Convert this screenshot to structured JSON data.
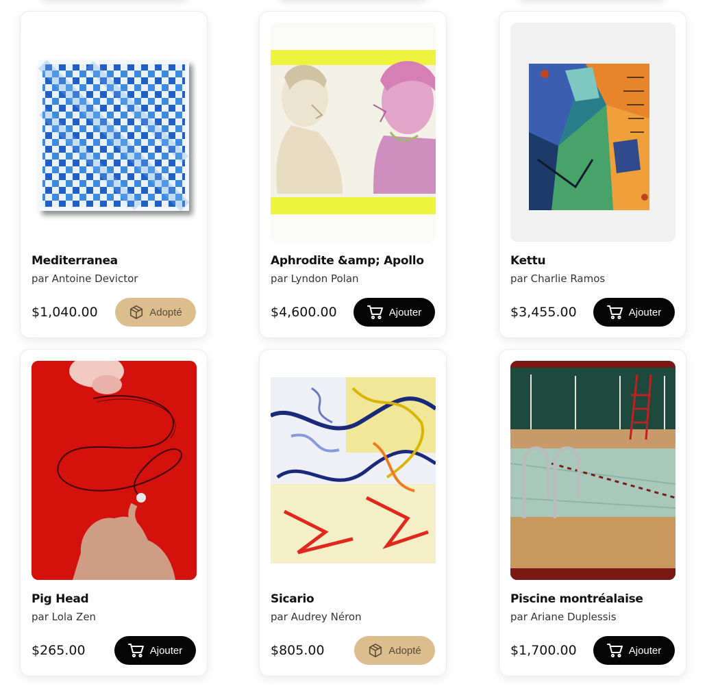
{
  "products": [
    {
      "title": "Mediterranea",
      "artist": "par Antoine Devictor",
      "price": "$1,040.00",
      "button": "Adopté",
      "status": "adopted",
      "icon": "box-icon"
    },
    {
      "title": "Aphrodite &amp; Apollo",
      "artist": "par Lyndon Polan",
      "price": "$4,600.00",
      "button": "Ajouter",
      "status": "available",
      "icon": "cart-icon"
    },
    {
      "title": "Kettu",
      "artist": "par Charlie Ramos",
      "price": "$3,455.00",
      "button": "Ajouter",
      "status": "available",
      "icon": "cart-icon"
    },
    {
      "title": "Pig Head",
      "artist": "par Lola Zen",
      "price": "$265.00",
      "button": "Ajouter",
      "status": "available",
      "icon": "cart-icon"
    },
    {
      "title": "Sicario",
      "artist": "par Audrey Néron",
      "price": "$805.00",
      "button": "Adopté",
      "status": "adopted",
      "icon": "box-icon"
    },
    {
      "title": "Piscine montréalaise",
      "artist": "par Ariane Duplessis",
      "price": "$1,700.00",
      "button": "Ajouter",
      "status": "available",
      "icon": "cart-icon"
    }
  ],
  "colors": {
    "buy_button": "#050505",
    "adopted_button": "#dcbd8e",
    "adopted_text": "#5a4a38"
  }
}
